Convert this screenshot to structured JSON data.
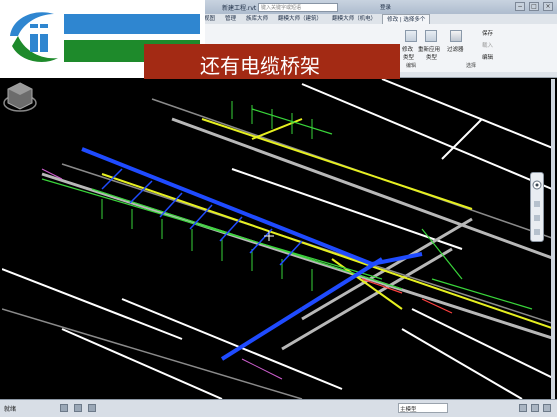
{
  "window": {
    "title": "新建工程.rvt",
    "search_placeholder": "键入关键字或短语",
    "login": "登录",
    "controls": [
      "−",
      "□",
      "×"
    ]
  },
  "tabs": [
    "视图",
    "管理",
    "族库大师",
    "翻模大师（建筑）",
    "翻模大师（机电）",
    "修改 | 选择多个"
  ],
  "ribbon": {
    "buttons": [
      {
        "label": "修改",
        "sub": "类型"
      },
      {
        "label": "重新应用",
        "sub": "类型"
      },
      {
        "label": "过滤器"
      },
      {
        "label": "保存"
      },
      {
        "label": "载入"
      },
      {
        "label": "编辑"
      }
    ],
    "panels": [
      "编辑",
      "选择"
    ]
  },
  "caption": "还有电缆桥架",
  "status": {
    "left_text": "就绪",
    "model": "主模型"
  },
  "colors": {
    "caption_bg": "#a32a14",
    "logo_blue": "#2f86d0",
    "logo_green": "#1e8a2b",
    "pipe_blue": "#1f4bff",
    "pipe_yellow": "#e6f020",
    "pipe_green": "#39d43a",
    "pipe_white": "#ffffff"
  },
  "icons": [
    "logo-icon",
    "viewcube-icon",
    "navbar-icon",
    "filter-icon"
  ]
}
